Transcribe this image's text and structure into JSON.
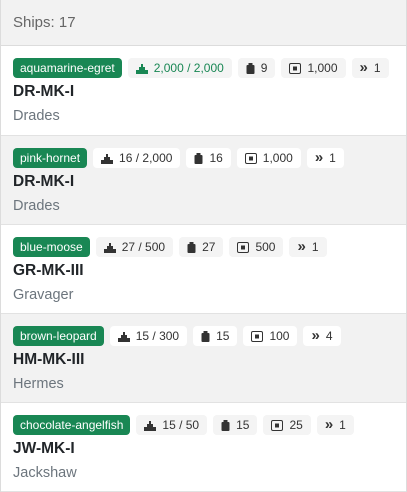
{
  "header": {
    "text": "Ships: 17"
  },
  "ships": [
    {
      "tag": "aquamarine-egret",
      "hull": "2,000 / 2,000",
      "crew": "9",
      "cargo": "1,000",
      "speed": "1",
      "code": "DR-MK-I",
      "maker": "Drades"
    },
    {
      "tag": "pink-hornet",
      "hull": "16 / 2,000",
      "crew": "16",
      "cargo": "1,000",
      "speed": "1",
      "code": "DR-MK-I",
      "maker": "Drades"
    },
    {
      "tag": "blue-moose",
      "hull": "27 / 500",
      "crew": "27",
      "cargo": "500",
      "speed": "1",
      "code": "GR-MK-III",
      "maker": "Gravager"
    },
    {
      "tag": "brown-leopard",
      "hull": "15 / 300",
      "crew": "15",
      "cargo": "100",
      "speed": "4",
      "code": "HM-MK-III",
      "maker": "Hermes"
    },
    {
      "tag": "chocolate-angelfish",
      "hull": "15 / 50",
      "crew": "15",
      "cargo": "25",
      "speed": "1",
      "code": "JW-MK-I",
      "maker": "Jackshaw"
    }
  ],
  "icons": {
    "hull": "hull-icon",
    "crew": "crew-icon",
    "cargo": "cargo-icon",
    "speed": "speed-icon"
  },
  "colors": {
    "tag_bg": "#198754",
    "hull_full": "#198754"
  }
}
